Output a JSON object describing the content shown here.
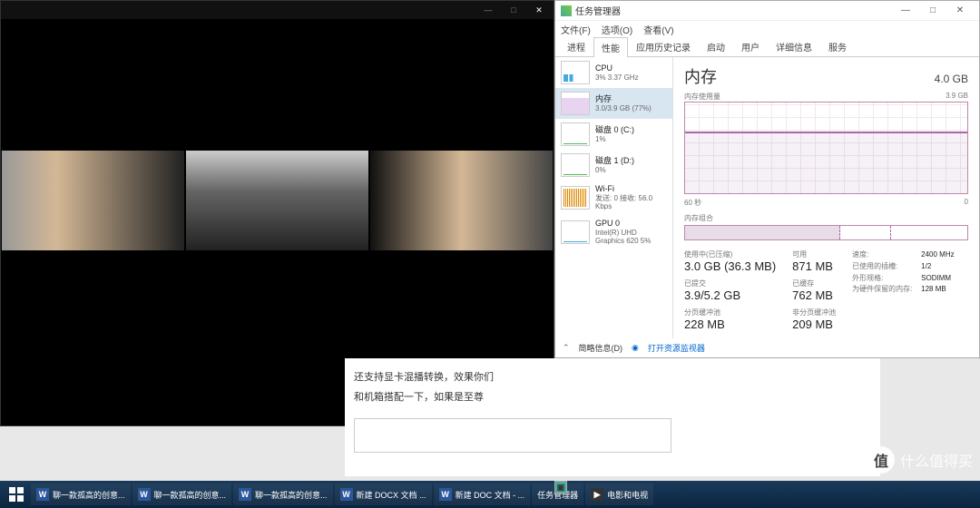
{
  "video": {
    "minimize": "—",
    "maximize": "□",
    "close": "✕"
  },
  "tm": {
    "title": "任务管理器",
    "win": {
      "min": "—",
      "max": "□",
      "close": "✕"
    },
    "menu": [
      "文件(F)",
      "选项(O)",
      "查看(V)"
    ],
    "tabs": [
      "进程",
      "性能",
      "应用历史记录",
      "启动",
      "用户",
      "详细信息",
      "服务"
    ],
    "active_tab": 1,
    "sidebar": [
      {
        "name": "CPU",
        "val": "3%  3.37 GHz",
        "cls": "cpu"
      },
      {
        "name": "内存",
        "val": "3.0/3.9 GB (77%)",
        "cls": "mem"
      },
      {
        "name": "磁盘 0 (C:)",
        "val": "1%",
        "cls": "disk"
      },
      {
        "name": "磁盘 1 (D:)",
        "val": "0%",
        "cls": "disk"
      },
      {
        "name": "Wi-Fi",
        "val": "发送: 0  接收: 56.0 Kbps",
        "cls": "wifi"
      },
      {
        "name": "GPU 0",
        "val": "Intel(R) UHD Graphics 620\n5%",
        "cls": "gpu"
      }
    ],
    "selected": 1,
    "main": {
      "title": "内存",
      "total": "4.0 GB",
      "usage_label": "内存使用量",
      "usage_max": "3.9 GB",
      "xaxis_left": "60 秒",
      "xaxis_right": "0",
      "compo_label": "内存组合",
      "stats_left": [
        {
          "lbl": "使用中(已压缩)",
          "val": "3.0 GB (36.3 MB)"
        },
        {
          "lbl": "已提交",
          "val": "3.9/5.2 GB"
        },
        {
          "lbl": "分页缓冲池",
          "val": "228 MB"
        }
      ],
      "stats_mid": [
        {
          "lbl": "可用",
          "val": "871 MB"
        },
        {
          "lbl": "已缓存",
          "val": "762 MB"
        },
        {
          "lbl": "非分页缓冲池",
          "val": "209 MB"
        }
      ],
      "stats_right": [
        {
          "lbl": "速度:",
          "val": "2400 MHz"
        },
        {
          "lbl": "已使用的插槽:",
          "val": "1/2"
        },
        {
          "lbl": "外形规格:",
          "val": "SODIMM"
        },
        {
          "lbl": "为硬件保留的内存:",
          "val": "128 MB"
        }
      ]
    },
    "footer": {
      "brief": "简略信息(D)",
      "link": "打开资源监视器"
    }
  },
  "doc": {
    "line1": "还支持显卡混播转换，效果你们",
    "line2": "和机箱搭配一下，如果是至尊"
  },
  "watermark": "什么值得买",
  "taskbar": [
    {
      "ico": "word",
      "label": "聊一款孤高的创意..."
    },
    {
      "ico": "word",
      "label": "聊一款孤高的创意..."
    },
    {
      "ico": "word",
      "label": "聊一款孤高的创意..."
    },
    {
      "ico": "word",
      "label": "新建 DOCX 文档 ..."
    },
    {
      "ico": "word",
      "label": "新建 DOC 文档 - ..."
    },
    {
      "ico": "tm",
      "label": "任务管理器"
    },
    {
      "ico": "vid",
      "label": "电影和电视"
    }
  ],
  "chart_data": {
    "type": "line",
    "title": "内存使用量",
    "xlabel": "秒",
    "ylabel": "GB",
    "x_range": [
      60,
      0
    ],
    "ylim": [
      0,
      3.9
    ],
    "series": [
      {
        "name": "内存",
        "values": [
          3.0,
          3.0,
          3.0,
          3.0,
          3.0,
          3.02,
          3.05,
          3.05,
          3.04,
          3.05,
          3.05,
          3.05,
          3.05,
          3.06,
          3.05,
          3.05
        ]
      }
    ]
  }
}
